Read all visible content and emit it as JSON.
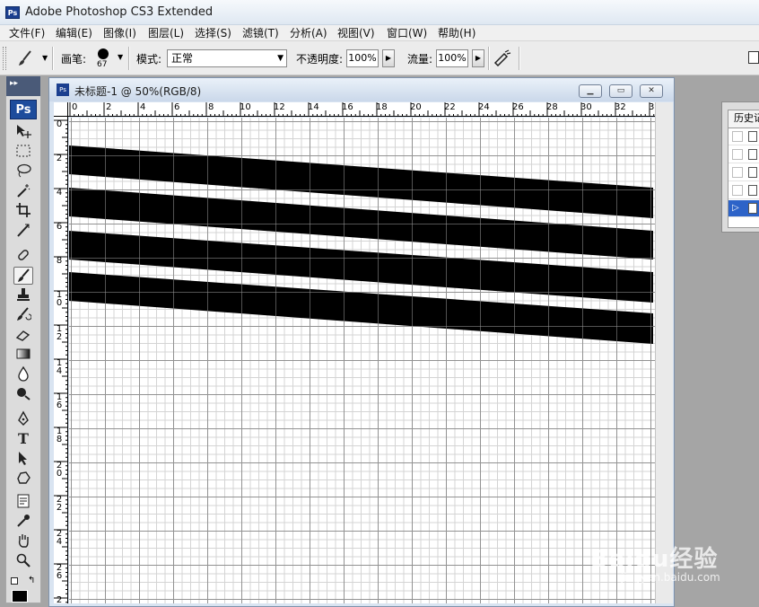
{
  "app": {
    "title": "Adobe Photoshop CS3 Extended",
    "logo": "Ps"
  },
  "menu": [
    "文件(F)",
    "编辑(E)",
    "图像(I)",
    "图层(L)",
    "选择(S)",
    "滤镜(T)",
    "分析(A)",
    "视图(V)",
    "窗口(W)",
    "帮助(H)"
  ],
  "options": {
    "brush_label": "画笔:",
    "brush_size": "67",
    "mode_label": "模式:",
    "mode_value": "正常",
    "opacity_label": "不透明度:",
    "opacity_value": "100%",
    "flow_label": "流量:",
    "flow_value": "100%"
  },
  "toolbox": {
    "badge": "Ps",
    "tools": [
      "move-tool",
      "marquee-tool",
      "lasso-tool",
      "magic-wand-tool",
      "crop-tool",
      "slice-tool",
      "healing-brush-tool",
      "brush-tool",
      "clone-stamp-tool",
      "history-brush-tool",
      "eraser-tool",
      "gradient-tool",
      "blur-tool",
      "dodge-tool",
      "pen-tool",
      "type-tool",
      "path-selection-tool",
      "shape-tool",
      "notes-tool",
      "eyedropper-tool",
      "hand-tool",
      "zoom-tool"
    ],
    "type_glyph": "T",
    "foreground_color": "#000000"
  },
  "document": {
    "title": "未标题-1 @ 50%(RGB/8)",
    "ruler_top": [
      "0",
      "2",
      "4",
      "6",
      "8",
      "10",
      "12",
      "14",
      "16",
      "18",
      "20",
      "22",
      "24",
      "26",
      "28",
      "30",
      "32",
      "3"
    ],
    "ruler_left": [
      "0",
      "2",
      "4",
      "6",
      "8",
      "1\n0",
      "1\n2",
      "1\n4",
      "1\n6",
      "1\n8",
      "2\n0",
      "2\n2",
      "2\n4",
      "2\n6",
      "2"
    ]
  },
  "history_panel": {
    "tab_label": "历史记"
  },
  "watermark": {
    "text": "Baidu经验",
    "url": "jingyan.baidu.com"
  }
}
